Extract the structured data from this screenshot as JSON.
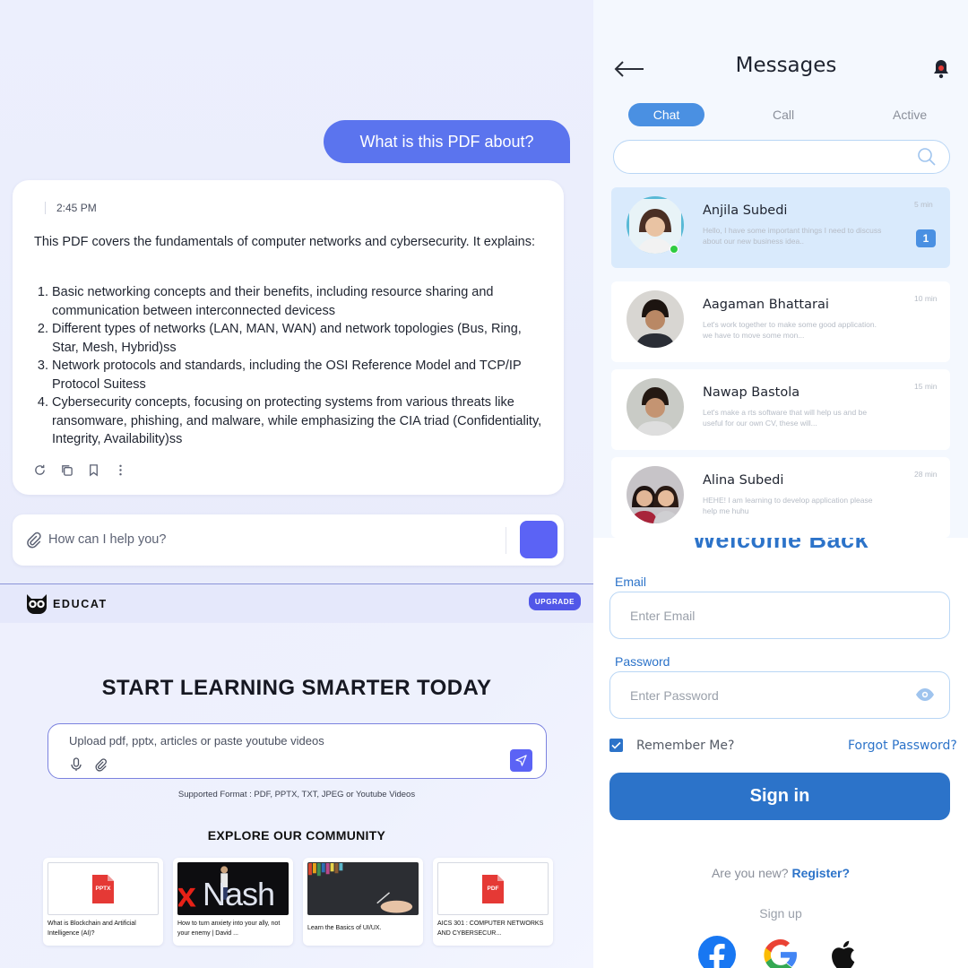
{
  "chat": {
    "user_message": "What is this PDF about?",
    "response": {
      "timestamp": "2:45 PM",
      "intro": "This PDF covers the fundamentals of computer networks and cybersecurity. It explains:",
      "items": [
        "Basic networking concepts and their benefits, including resource sharing and communication between interconnected devicess",
        "Different types of networks (LAN, MAN, WAN) and network topologies (Bus, Ring, Star, Mesh, Hybrid)ss",
        "Network protocols and standards, including the OSI Reference Model and TCP/IP Protocol Suitess",
        "Cybersecurity concepts, focusing on protecting systems from various threats like ransomware, phishing, and malware, while emphasizing the CIA triad (Confidentiality, Integrity, Availability)ss"
      ],
      "action_icons": [
        "refresh-icon",
        "copy-icon",
        "bookmark-icon",
        "more-icon"
      ]
    },
    "input": {
      "placeholder": "How can I help you?"
    },
    "colors": {
      "accent": "#5b74ee",
      "send": "#5b63f5"
    }
  },
  "educat": {
    "brand": "EDUCAT",
    "upgrade_label": "UPGRADE",
    "hero_title": "START LEARNING SMARTER TODAY",
    "upload_placeholder": "Upload pdf, pptx, articles or paste youtube videos",
    "supported_formats": "Supported Format : PDF, PPTX, TXT, JPEG or Youtube Videos",
    "community_title": "EXPLORE OUR COMMUNITY",
    "cards": [
      {
        "type": "pptx",
        "badge": "PPTX",
        "title": "What is Blockchain and Artificial Intelligence (AI)?"
      },
      {
        "type": "video",
        "thumb_text": "Nash",
        "title": "How to turn anxiety into your ally, not your enemy | David ..."
      },
      {
        "type": "image",
        "title": "Learn the Basics of UI/UX."
      },
      {
        "type": "pdf",
        "badge": "PDF",
        "title": "AICS 301 : COMPUTER NETWORKS AND CYBERSECUR..."
      }
    ]
  },
  "messages": {
    "title": "Messages",
    "tabs": [
      "Chat",
      "Call",
      "Active"
    ],
    "contacts": [
      {
        "name": "Anjila Subedi",
        "preview": "Hello, I have some important things I need to discuss about our new business idea..",
        "time": "5 min",
        "unread": "1",
        "online": true
      },
      {
        "name": "Aagaman Bhattarai",
        "preview": "Let's work together to make some good application. we have to move some mon...",
        "time": "10 min"
      },
      {
        "name": "Nawap Bastola",
        "preview": "Let's make a rts software that will help us and be useful for our own CV, these will...",
        "time": "15 min"
      },
      {
        "name": "Alina Subedi",
        "preview": "HEHE! I am learning to develop application please help me huhu",
        "time": "28 min"
      }
    ]
  },
  "login": {
    "heading": "Welcome Back",
    "email_label": "Email",
    "email_placeholder": "Enter Email",
    "password_label": "Password",
    "password_placeholder": "Enter Password",
    "remember_label": "Remember Me?",
    "forgot_label": "Forgot Password?",
    "signin_label": "Sign in",
    "new_prompt": "Are you new?",
    "register_label": "Register?",
    "signup_label": "Sign up",
    "social": [
      "facebook-icon",
      "google-icon",
      "apple-icon"
    ],
    "colors": {
      "primary": "#2c73c9"
    }
  }
}
